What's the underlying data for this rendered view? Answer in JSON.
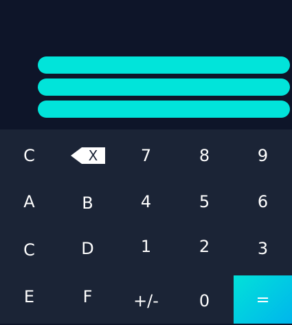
{
  "display": {
    "bars": 3,
    "color": "#01e4da"
  },
  "keys": {
    "clear": "C",
    "backspace": "X",
    "k7": "7",
    "k8": "8",
    "k9": "9",
    "kA": "A",
    "kB": "B",
    "k4": "4",
    "k5": "5",
    "k6": "6",
    "kC": "C",
    "kD": "D",
    "k1": "1",
    "k2": "2",
    "k3": "3",
    "kE": "E",
    "kF": "F",
    "negate": "+/-",
    "k0": "0",
    "equals": "="
  },
  "colors": {
    "background": "#0e1529",
    "keypad": "#1b2436",
    "accent": "#01e4da"
  }
}
